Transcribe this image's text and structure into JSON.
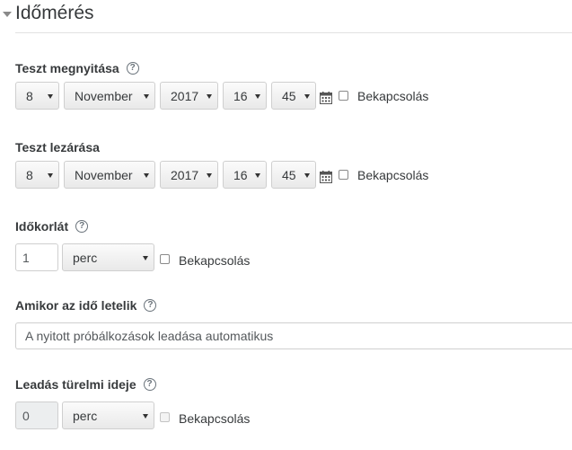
{
  "section": {
    "title": "Időmérés"
  },
  "open": {
    "label": "Teszt megnyitása",
    "help": "?",
    "day": "8",
    "month": "November",
    "year": "2017",
    "hour": "16",
    "minute": "45",
    "enable_label": "Bekapcsolás"
  },
  "close": {
    "label": "Teszt lezárása",
    "day": "8",
    "month": "November",
    "year": "2017",
    "hour": "16",
    "minute": "45",
    "enable_label": "Bekapcsolás"
  },
  "timelimit": {
    "label": "Időkorlát",
    "help": "?",
    "value": "1",
    "unit": "perc",
    "enable_label": "Bekapcsolás"
  },
  "overdue": {
    "label": "Amikor az idő letelik",
    "help": "?",
    "value": "A nyitott próbálkozások leadása automatikus"
  },
  "grace": {
    "label": "Leadás türelmi ideje",
    "help": "?",
    "value": "0",
    "unit": "perc",
    "enable_label": "Bekapcsolás"
  }
}
